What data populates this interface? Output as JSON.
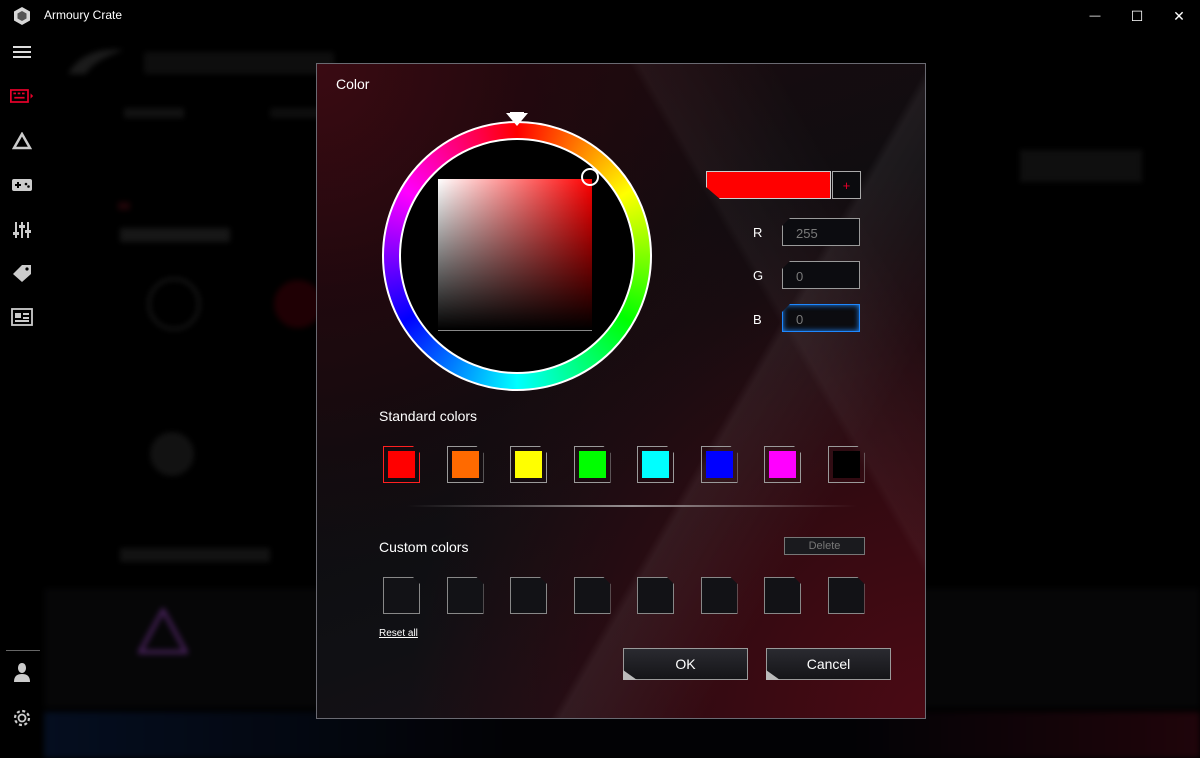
{
  "window": {
    "title": "Armoury Crate",
    "minimize_glyph": "—",
    "maximize_glyph": "☐",
    "close_glyph": "✕"
  },
  "sidebar": {
    "items": [
      {
        "icon": "menu-icon"
      },
      {
        "icon": "keyboard-device-icon"
      },
      {
        "icon": "aura-sync-icon"
      },
      {
        "icon": "gamepad-icon"
      },
      {
        "icon": "equalizer-icon"
      },
      {
        "icon": "tag-icon"
      },
      {
        "icon": "news-icon"
      },
      {
        "icon": "user-icon"
      },
      {
        "icon": "settings-icon"
      }
    ],
    "active_accent": "#e8002a"
  },
  "dialog": {
    "title": "Color",
    "preview_color": "#ff0000",
    "add_symbol": "+",
    "rgb": {
      "r_label": "R",
      "r_value": "255",
      "g_label": "G",
      "g_value": "0",
      "b_label": "B",
      "b_value": "0"
    },
    "standard_colors_label": "Standard colors",
    "standard_colors": [
      "#ff0000",
      "#ff6a00",
      "#ffff00",
      "#00ff00",
      "#00ffff",
      "#0000ff",
      "#ff00ff",
      "#000000"
    ],
    "selected_standard_index": 0,
    "custom_colors_label": "Custom colors",
    "delete_label": "Delete",
    "custom_slot_count": 8,
    "reset_label": "Reset all",
    "ok_label": "OK",
    "cancel_label": "Cancel"
  }
}
